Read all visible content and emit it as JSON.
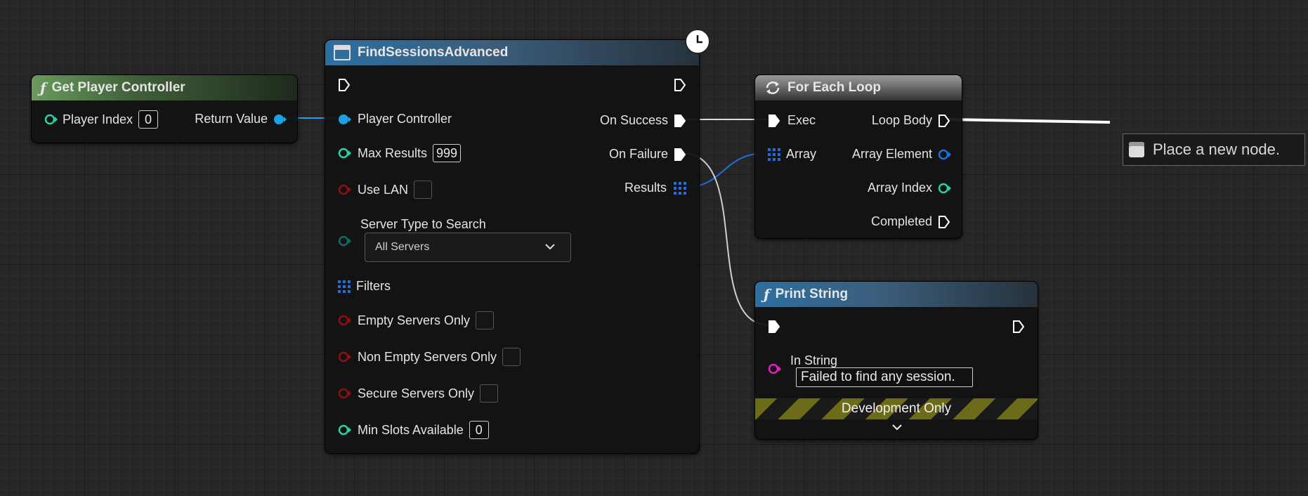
{
  "nodes": {
    "get_player_controller": {
      "title": "Get Player Controller",
      "icon": "function-icon",
      "inputs": {
        "player_index_label": "Player Index",
        "player_index_value": "0"
      },
      "outputs": {
        "return_value_label": "Return Value"
      }
    },
    "find_sessions": {
      "title": "FindSessionsAdvanced",
      "latent_icon": "clock-icon",
      "inputs": {
        "player_controller": "Player Controller",
        "max_results_label": "Max Results",
        "max_results_value": "999",
        "use_lan": "Use LAN",
        "server_type_label": "Server Type to Search",
        "server_type_value": "All Servers",
        "filters": "Filters",
        "empty_servers_only": "Empty Servers Only",
        "non_empty_servers_only": "Non Empty Servers Only",
        "secure_servers_only": "Secure Servers Only",
        "min_slots_label": "Min Slots Available",
        "min_slots_value": "0"
      },
      "outputs": {
        "on_success": "On Success",
        "on_failure": "On Failure",
        "results": "Results"
      }
    },
    "for_each_loop": {
      "title": "For Each Loop",
      "icon": "loop-icon",
      "inputs": {
        "exec": "Exec",
        "array": "Array"
      },
      "outputs": {
        "loop_body": "Loop Body",
        "array_element": "Array Element",
        "array_index": "Array Index",
        "completed": "Completed"
      }
    },
    "print_string": {
      "title": "Print String",
      "icon": "function-icon",
      "inputs": {
        "in_string_label": "In String",
        "in_string_value": "Failed to find any session."
      },
      "footer": "Development Only"
    }
  },
  "tooltip": {
    "text": "Place a new node."
  },
  "colors": {
    "exec": "#ffffff",
    "object_pin": "#1ea0e6",
    "int_pin": "#2ad0a6",
    "bool_pin": "#8c1212",
    "string_pin": "#e021c0",
    "byte_pin": "#0f6b5e",
    "struct_array_pin": "#1e6fe0"
  }
}
